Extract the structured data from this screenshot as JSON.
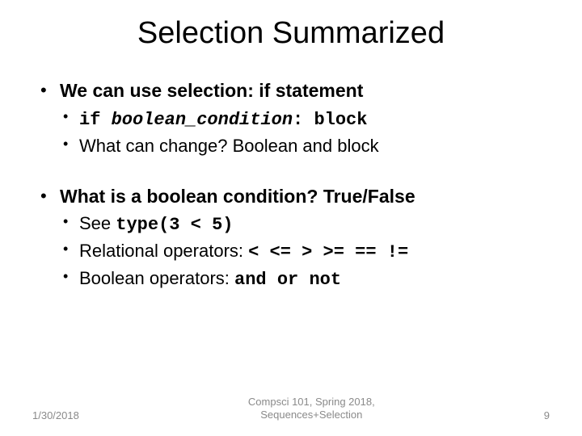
{
  "title": "Selection Summarized",
  "bullets": [
    {
      "heading": "We can use selection: if statement",
      "subs": [
        {
          "prefix": "if ",
          "italic": "boolean_condition",
          "suffix": ": block",
          "mono": true
        },
        {
          "text": "What can change? Boolean and block"
        }
      ]
    },
    {
      "heading": "What is a boolean condition? True/False",
      "subs": [
        {
          "text_pre": "See ",
          "mono_text": "type(3 < 5)"
        },
        {
          "text_pre": "Relational operators: ",
          "mono_text": "< <= > >= == !="
        },
        {
          "text_pre": "Boolean operators: ",
          "mono_text": "and or not"
        }
      ]
    }
  ],
  "footer": {
    "date": "1/30/2018",
    "center_line1": "Compsci 101, Spring 2018,",
    "center_line2": "Sequences+Selection",
    "page": "9"
  }
}
